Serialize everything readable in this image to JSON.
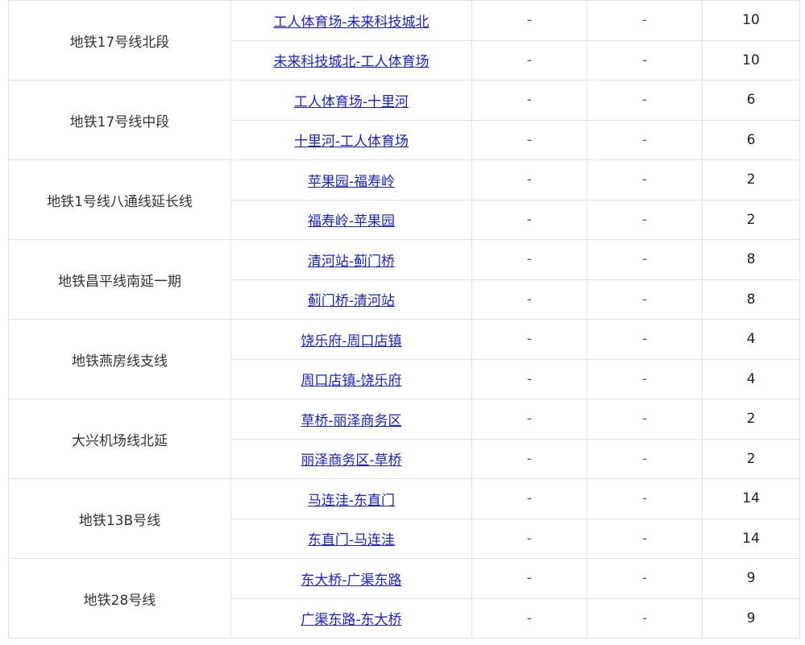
{
  "groups": [
    {
      "line": "地铁17号线北段",
      "rows": [
        {
          "route": "工人体育场-未来科技城北",
          "col3": "-",
          "col4": "-",
          "count": "10"
        },
        {
          "route": "未来科技城北-工人体育场",
          "col3": "-",
          "col4": "-",
          "count": "10"
        }
      ]
    },
    {
      "line": "地铁17号线中段",
      "rows": [
        {
          "route": "工人体育场-十里河",
          "col3": "-",
          "col4": "-",
          "count": "6"
        },
        {
          "route": "十里河-工人体育场",
          "col3": "-",
          "col4": "-",
          "count": "6"
        }
      ]
    },
    {
      "line": "地铁1号线八通线延长线",
      "rows": [
        {
          "route": "苹果园-福寿岭",
          "col3": "-",
          "col4": "-",
          "count": "2"
        },
        {
          "route": "福寿岭-苹果园",
          "col3": "-",
          "col4": "-",
          "count": "2"
        }
      ]
    },
    {
      "line": "地铁昌平线南延一期",
      "rows": [
        {
          "route": "清河站-蓟门桥",
          "col3": "-",
          "col4": "-",
          "count": "8"
        },
        {
          "route": "蓟门桥-清河站",
          "col3": "-",
          "col4": "-",
          "count": "8"
        }
      ]
    },
    {
      "line": "地铁燕房线支线",
      "rows": [
        {
          "route": "饶乐府-周口店镇",
          "col3": "-",
          "col4": "-",
          "count": "4"
        },
        {
          "route": "周口店镇-饶乐府",
          "col3": "-",
          "col4": "-",
          "count": "4"
        }
      ]
    },
    {
      "line": "大兴机场线北延",
      "rows": [
        {
          "route": "草桥-丽泽商务区",
          "col3": "-",
          "col4": "-",
          "count": "2"
        },
        {
          "route": "丽泽商务区-草桥",
          "col3": "-",
          "col4": "-",
          "count": "2"
        }
      ]
    },
    {
      "line": "地铁13B号线",
      "rows": [
        {
          "route": "马连洼-东直门",
          "col3": "-",
          "col4": "-",
          "count": "14"
        },
        {
          "route": "东直门-马连洼",
          "col3": "-",
          "col4": "-",
          "count": "14"
        }
      ]
    },
    {
      "line": "地铁28号线",
      "rows": [
        {
          "route": "东大桥-广渠东路",
          "col3": "-",
          "col4": "-",
          "count": "9"
        },
        {
          "route": "广渠东路-东大桥",
          "col3": "-",
          "col4": "-",
          "count": "9"
        }
      ]
    }
  ]
}
